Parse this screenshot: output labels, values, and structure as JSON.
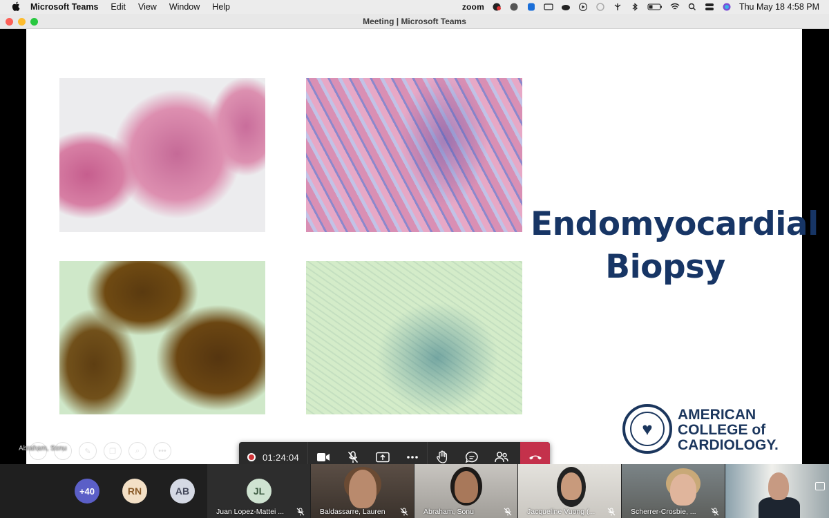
{
  "menubar": {
    "app_name": "Microsoft Teams",
    "menus": [
      "Edit",
      "View",
      "Window",
      "Help"
    ],
    "zoom_label": "zoom",
    "clock": "Thu May 18  4:58 PM"
  },
  "window": {
    "title": "Meeting | Microsoft Teams"
  },
  "slide": {
    "title_line1": "Endomyocardial",
    "title_line2": "Biopsy",
    "title_color": "#173565",
    "logo_line1": "AMERICAN",
    "logo_line2": "COLLEGE of",
    "logo_line3": "CARDIOLOGY.",
    "presenter_label": "Abraham, Sonu"
  },
  "call_controls": {
    "timer": "01:24:04",
    "recording": true,
    "hangup_color": "#c4314b"
  },
  "gallery": {
    "overflow_count": "+40",
    "avatars": [
      {
        "initials": "RN"
      },
      {
        "initials": "AB"
      }
    ],
    "tiles": [
      {
        "initials": "JL",
        "name": "Juan Lopez-Mattei ..."
      },
      {
        "name": "Baldassarre, Lauren"
      },
      {
        "name": "Abraham, Sonu"
      },
      {
        "name": "Jacqueline Vuong (..."
      },
      {
        "name": "Scherrer-Crosbie, ..."
      }
    ]
  }
}
